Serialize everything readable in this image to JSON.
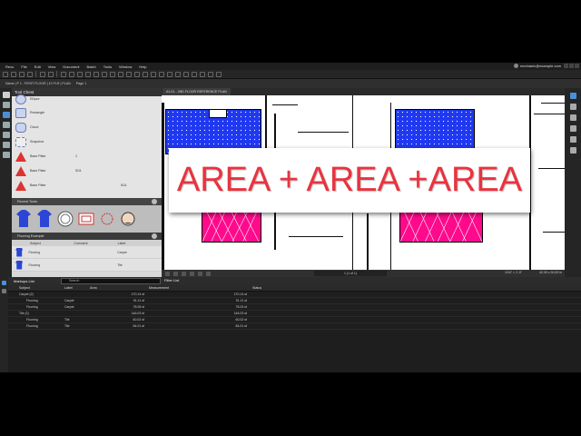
{
  "menu": [
    "Revu",
    "File",
    "Edit",
    "View",
    "Document",
    "Batch",
    "Tools",
    "Window",
    "Help"
  ],
  "user": "mechanic@example.com",
  "propbar": {
    "doc": "Name | P 1 - FIRST FLOOR | 10 FLR | PLAN",
    "page": "Page 1"
  },
  "toolchest": {
    "title": "Tool Chest",
    "items": [
      {
        "label": "Ellipse",
        "c2": "",
        "c3": ""
      },
      {
        "label": "Rectangle",
        "c2": "",
        "c3": ""
      },
      {
        "label": "Cloud",
        "c2": "",
        "c3": ""
      },
      {
        "label": "Snapshot",
        "c2": "",
        "c3": ""
      },
      {
        "label": "Base Plate",
        "c2": "1",
        "c3": ""
      },
      {
        "label": "Base Plate",
        "c2": "5/11",
        "c3": ""
      },
      {
        "label": "Base Plate",
        "c2": "",
        "c3": "5/11"
      }
    ],
    "recent_title": "Recent Tools",
    "flooring_title": "Flooring Example",
    "flooring_cols": [
      "Subject",
      "Comment",
      "Label"
    ],
    "flooring_rows": [
      {
        "subject": "Flooring",
        "comment": "",
        "label": "Carpet"
      },
      {
        "subject": "Flooring",
        "comment": "",
        "label": "Tile"
      }
    ]
  },
  "doc_tab": "A1.01 - 2ND FLOOR REFERENCE PLAN",
  "banner": "AREA + AREA +AREA",
  "statusbar": {
    "page": "1 (1 of 1)",
    "scale": "1/16\" = 1'-0\"",
    "dim": "42.00 x 30.00 in"
  },
  "markups": {
    "title": "Markups List",
    "search_placeholder": "Search",
    "filter": "Filter List",
    "cols": {
      "subject": "Subject",
      "label": "Label",
      "area": "Area",
      "measurement": "Measurement",
      "status": "Status"
    },
    "rows": [
      {
        "subject": "Carpet (2)",
        "label": "",
        "area": "170.14 sf",
        "meas": "170.14 sf",
        "group": true
      },
      {
        "subject": "Flooring",
        "label": "Carpet",
        "area": "91.11 sf",
        "meas": "91.11 sf",
        "group": false
      },
      {
        "subject": "Flooring",
        "label": "Carpet",
        "area": "78.08 sf",
        "meas": "78.03 sf",
        "group": false
      },
      {
        "subject": "Tile (2)",
        "label": "",
        "area": "146.03 sf",
        "meas": "146.03 sf",
        "group": true
      },
      {
        "subject": "Flooring",
        "label": "Tile",
        "area": "60.02 sf",
        "meas": "60.02 sf",
        "group": false
      },
      {
        "subject": "Flooring",
        "label": "Tile",
        "area": "84.01 sf",
        "meas": "84.01 sf",
        "group": false
      }
    ]
  },
  "colors": {
    "blue_area": "#1f38f0",
    "pink_area": "#ff0a8c",
    "banner_text": "#e8343f"
  }
}
